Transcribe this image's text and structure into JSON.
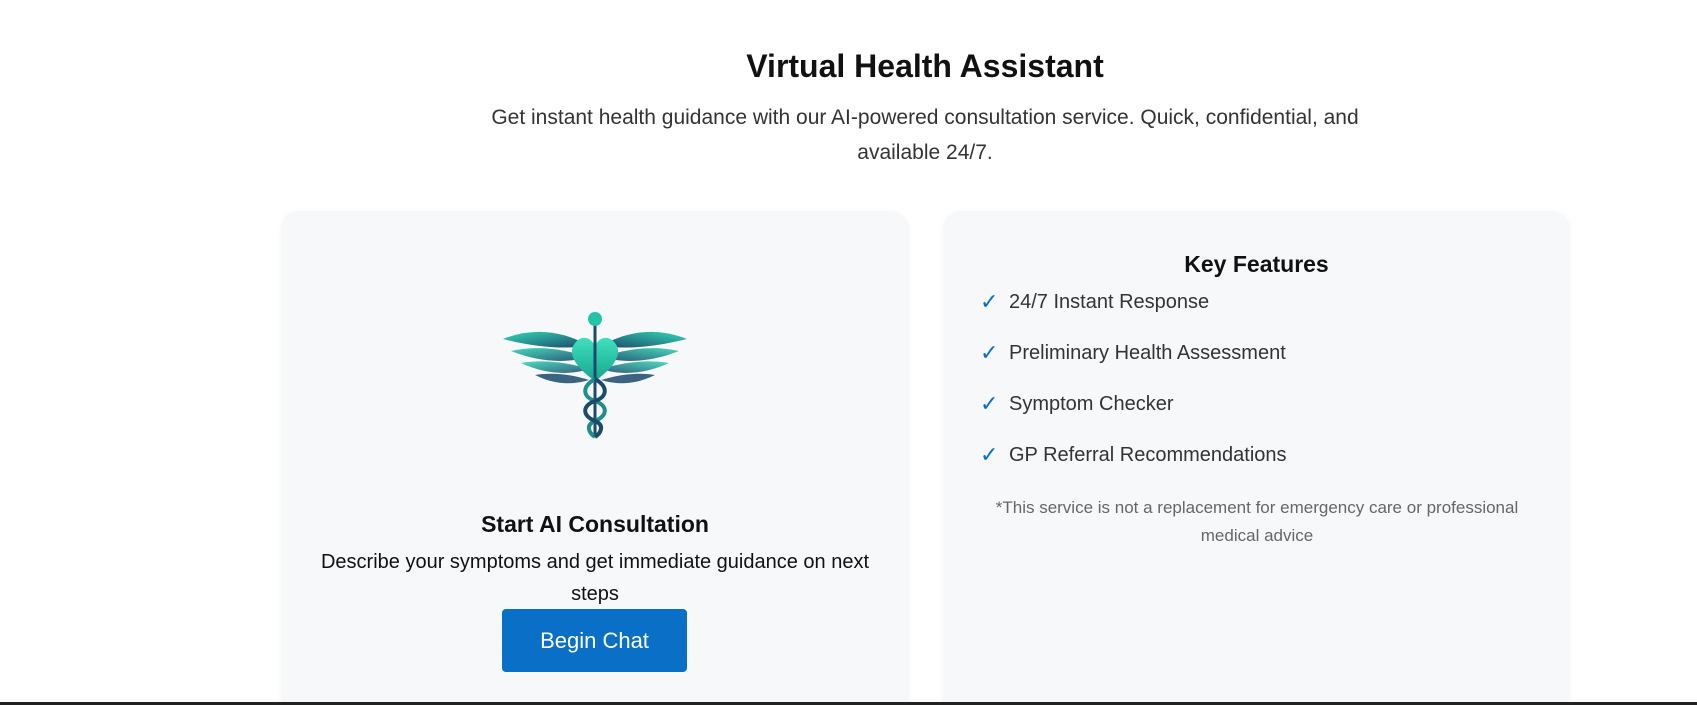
{
  "hero": {
    "title": "Virtual Health Assistant",
    "subtitle": "Get instant health guidance with our AI-powered consultation service. Quick, confidential, and available 24/7."
  },
  "consultation": {
    "logo_icon": "caduceus-heart-icon",
    "title": "Start AI Consultation",
    "description": "Describe your symptoms and get immediate guidance on next steps",
    "button_label": "Begin Chat"
  },
  "features": {
    "title": "Key Features",
    "check_icon": "checkmark-icon",
    "check_glyph": "✓",
    "items": [
      "24/7 Instant Response",
      "Preliminary Health Assessment",
      "Symptom Checker",
      "GP Referral Recommendations"
    ],
    "disclaimer": "*This service is not a replacement for emergency care or professional medical advice"
  },
  "colors": {
    "accent": "#0a6fc7",
    "card_background": "#f7f8fa",
    "logo_teal": "#22c3a6",
    "logo_navy": "#1b4a6b"
  }
}
